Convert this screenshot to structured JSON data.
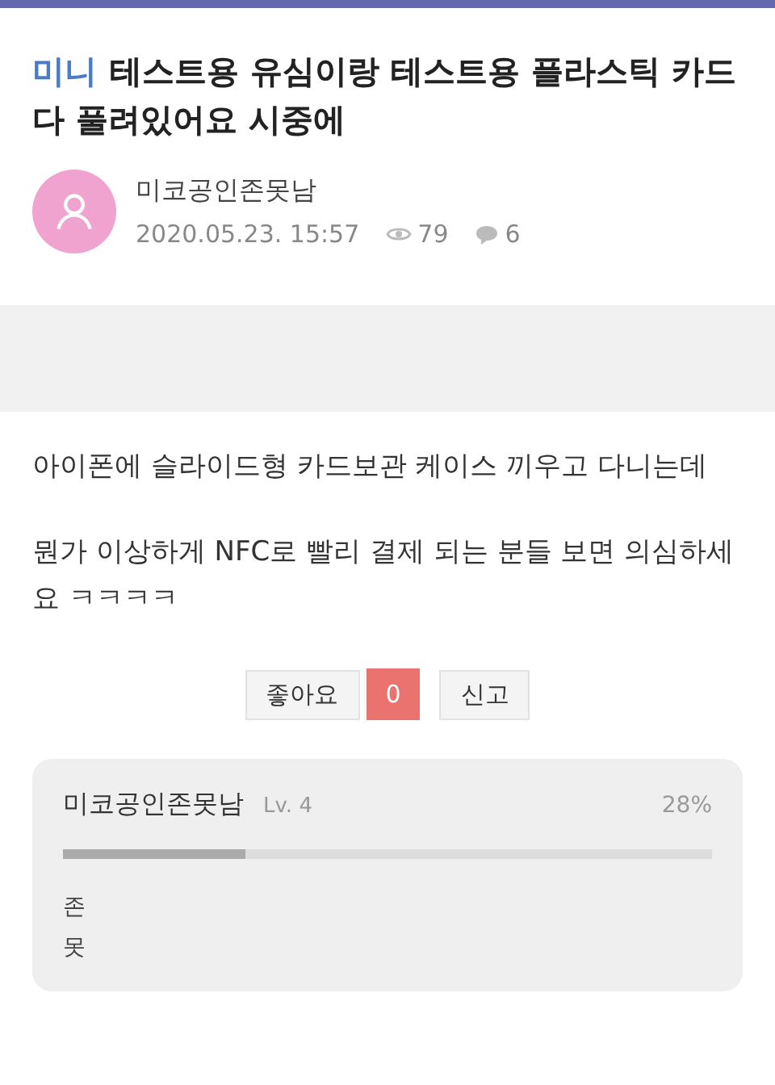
{
  "post": {
    "category": "미니",
    "title": "테스트용 유심이랑 테스트용 플라스틱 카드 다 풀려있어요 시중에",
    "author": "미코공인존못남",
    "date": "2020.05.23. 15:57",
    "views": "79",
    "comments": "6"
  },
  "body": [
    "아이폰에 슬라이드형 카드보관 케이스 끼우고 다니는데",
    "뭔가 이상하게 NFC로 빨리 결제 되는 분들 보면 의심하세요 ㅋㅋㅋㅋ"
  ],
  "actions": {
    "like_label": "좋아요",
    "like_count": "0",
    "report_label": "신고"
  },
  "profile": {
    "name": "미코공인존못남",
    "level_label": "Lv. 4",
    "percent": "28%",
    "level": 0.28,
    "bio_lines": [
      "존",
      "못"
    ]
  }
}
